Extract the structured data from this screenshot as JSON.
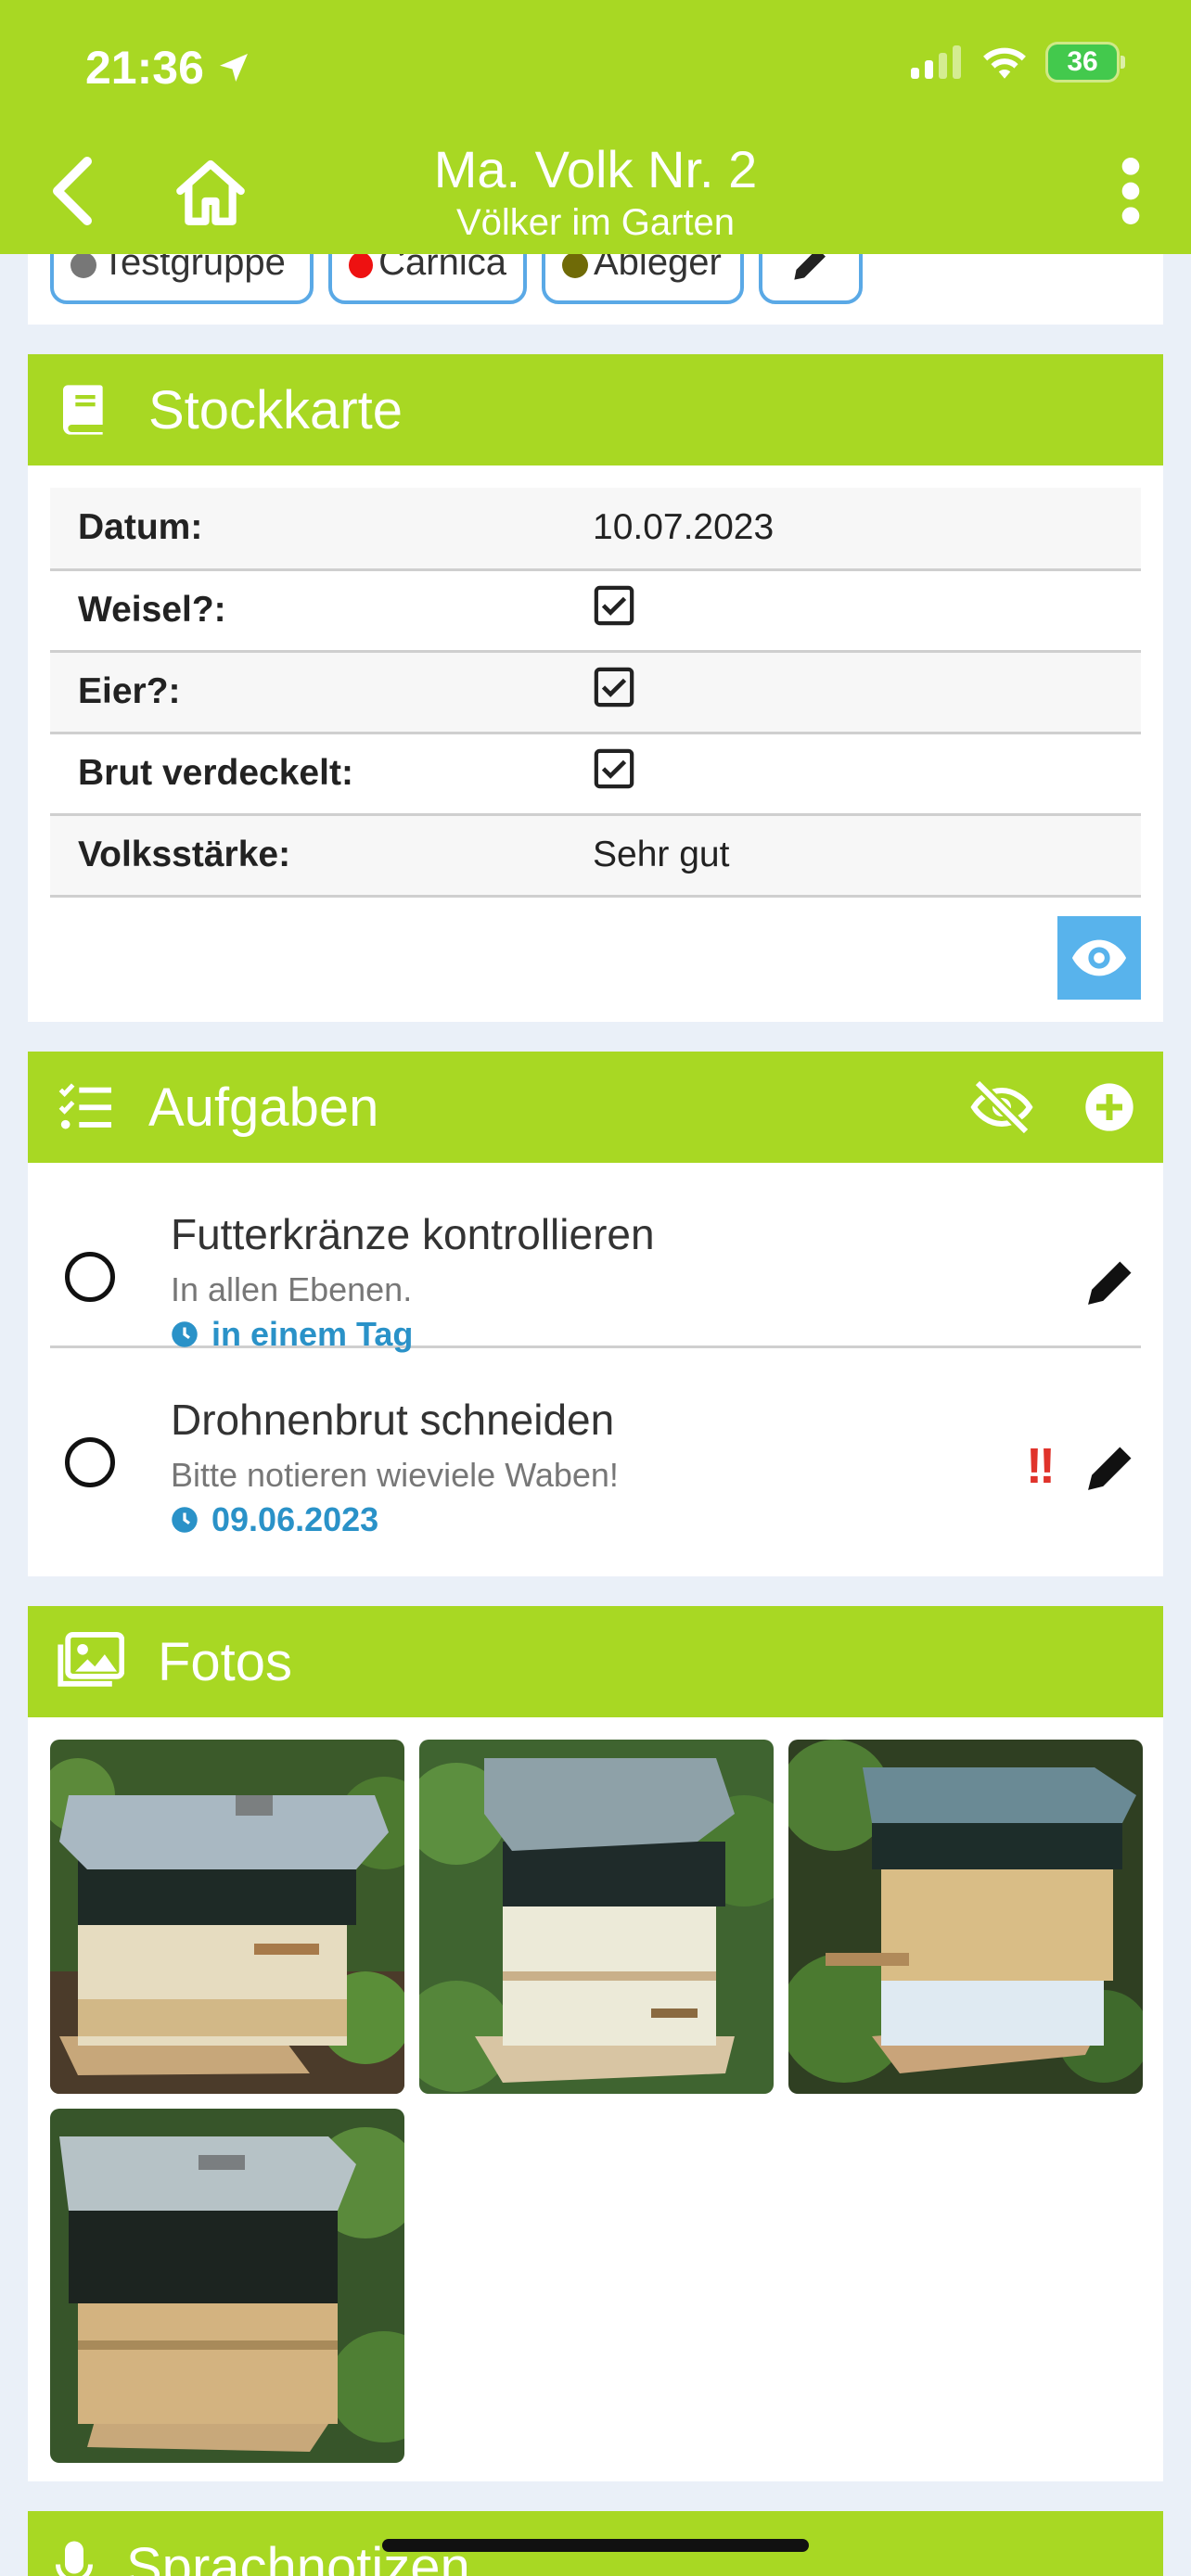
{
  "status_bar": {
    "time": "21:36",
    "battery": "36"
  },
  "header": {
    "title": "Ma. Volk Nr. 2",
    "subtitle": "Völker im Garten"
  },
  "tags": [
    {
      "label": "Testgruppe",
      "color": "#777777"
    },
    {
      "label": "Carnica",
      "color": "#ee1111"
    },
    {
      "label": "Ableger",
      "color": "#6f6a07"
    }
  ],
  "stockkarte": {
    "title": "Stockkarte",
    "rows": [
      {
        "label": "Datum:",
        "value": "10.07.2023"
      },
      {
        "label": "Weisel?:",
        "value": ""
      },
      {
        "label": "Eier?:",
        "value": ""
      },
      {
        "label": "Brut verdeckelt:",
        "value": ""
      },
      {
        "label": "Volksstärke:",
        "value": "Sehr gut"
      }
    ]
  },
  "aufgaben": {
    "title": "Aufgaben",
    "tasks": [
      {
        "title": "Futterkränze kontrollieren",
        "desc": "In allen Ebenen.",
        "due": "in einem Tag",
        "priority": ""
      },
      {
        "title": "Drohnenbrut schneiden",
        "desc": "Bitte notieren wieviele Waben!",
        "due": "09.06.2023",
        "priority": "!!"
      }
    ]
  },
  "fotos": {
    "title": "Fotos"
  },
  "sprachnotizen": {
    "title": "Sprachnotizen"
  },
  "colors": {
    "accent": "#a8d823",
    "link": "#2a92c8",
    "tag_border": "#5aa9e6",
    "alert": "#e0332b"
  }
}
